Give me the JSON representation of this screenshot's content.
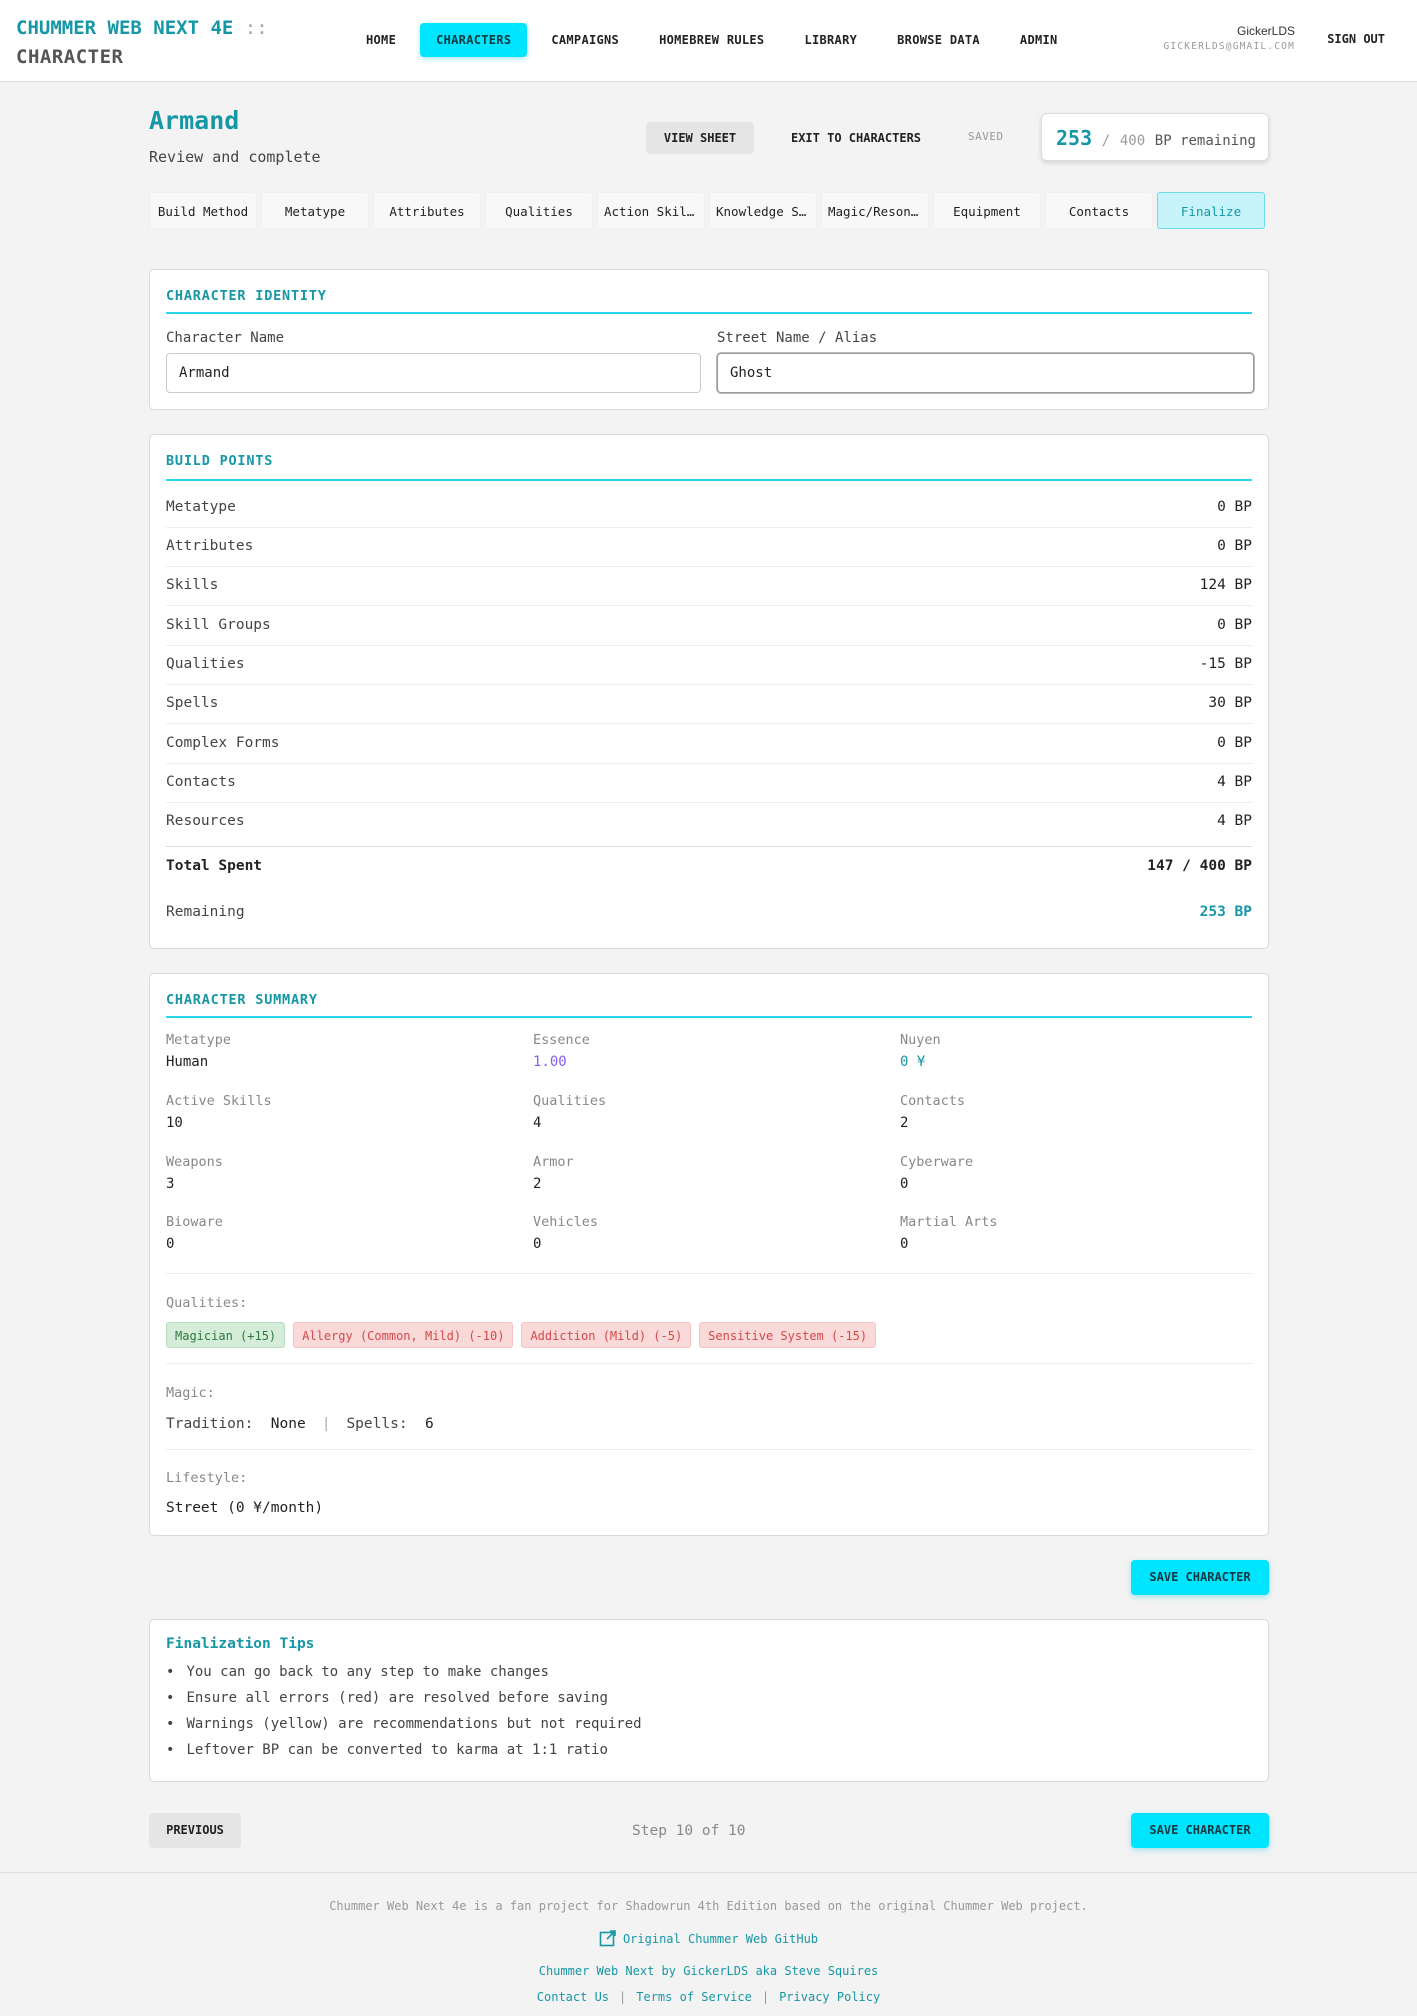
{
  "header": {
    "brand_line1": "CHUMMER WEB NEXT 4E",
    "brand_sep": "::",
    "brand_line2": "CHARACTER",
    "nav": [
      {
        "label": "HOME",
        "active": false
      },
      {
        "label": "CHARACTERS",
        "active": true
      },
      {
        "label": "CAMPAIGNS",
        "active": false
      },
      {
        "label": "HOMEBREW RULES",
        "active": false
      },
      {
        "label": "LIBRARY",
        "active": false
      },
      {
        "label": "BROWSE DATA",
        "active": false
      },
      {
        "label": "ADMIN",
        "active": false
      }
    ],
    "username": "GickerLDS",
    "email": "GICKERLDS@GMAIL.COM",
    "sign_out": "SIGN OUT"
  },
  "page": {
    "title": "Armand",
    "subtitle": "Review and complete",
    "view_sheet": "VIEW SHEET",
    "exit": "EXIT TO CHARACTERS",
    "saved": "SAVED",
    "bp_remaining": "253",
    "bp_slash": "/",
    "bp_max": "400",
    "bp_label": "BP remaining"
  },
  "tabs": [
    "Build Method",
    "Metatype",
    "Attributes",
    "Qualities",
    "Action Skills",
    "Knowledge Skills",
    "Magic/Resonance",
    "Equipment",
    "Contacts",
    "Finalize"
  ],
  "identity": {
    "title": "CHARACTER IDENTITY",
    "name_label": "Character Name",
    "name_value": "Armand",
    "alias_label": "Street Name / Alias",
    "alias_value": "Ghost"
  },
  "build_points": {
    "title": "BUILD POINTS",
    "rows": [
      {
        "k": "Metatype",
        "v": "0 BP"
      },
      {
        "k": "Attributes",
        "v": "0 BP"
      },
      {
        "k": "Skills",
        "v": "124 BP"
      },
      {
        "k": "Skill Groups",
        "v": "0 BP"
      },
      {
        "k": "Qualities",
        "v": "-15 BP"
      },
      {
        "k": "Spells",
        "v": "30 BP"
      },
      {
        "k": "Complex Forms",
        "v": "0 BP"
      },
      {
        "k": "Contacts",
        "v": "4 BP"
      },
      {
        "k": "Resources",
        "v": "4 BP"
      }
    ],
    "total_label": "Total Spent",
    "total_value": "147 / 400 BP",
    "remaining_label": "Remaining",
    "remaining_value": "253 BP"
  },
  "summary": {
    "title": "CHARACTER SUMMARY",
    "cells": [
      {
        "l": "Metatype",
        "v": "Human"
      },
      {
        "l": "Essence",
        "v": "1.00"
      },
      {
        "l": "Nuyen",
        "v": "0 ¥"
      },
      {
        "l": "Active Skills",
        "v": "10"
      },
      {
        "l": "Qualities",
        "v": "4"
      },
      {
        "l": "Contacts",
        "v": "2"
      },
      {
        "l": "Weapons",
        "v": "3"
      },
      {
        "l": "Armor",
        "v": "2"
      },
      {
        "l": "Cyberware",
        "v": "0"
      },
      {
        "l": "Bioware",
        "v": "0"
      },
      {
        "l": "Vehicles",
        "v": "0"
      },
      {
        "l": "Martial Arts",
        "v": "0"
      }
    ],
    "qualities_label": "Qualities:",
    "qualities": [
      {
        "text": "Magician (+15)",
        "kind": "positive"
      },
      {
        "text": "Allergy (Common, Mild) (-10)",
        "kind": "negative"
      },
      {
        "text": "Addiction (Mild) (-5)",
        "kind": "negative"
      },
      {
        "text": "Sensitive System (-15)",
        "kind": "negative"
      }
    ],
    "magic_label": "Magic:",
    "tradition_label": "Tradition:",
    "tradition_value": "None",
    "spells_label": "Spells:",
    "spells_value": "6",
    "lifestyle_label": "Lifestyle:",
    "lifestyle_value": "Street (0 ¥/month)"
  },
  "save_label": "SAVE CHARACTER",
  "tips": {
    "title": "Finalization Tips",
    "items": [
      "You can go back to any step to make changes",
      "Ensure all errors (red) are resolved before saving",
      "Warnings (yellow) are recommendations but not required",
      "Leftover BP can be converted to karma at 1:1 ratio"
    ]
  },
  "pager": {
    "previous": "PREVIOUS",
    "step": "Step 10 of 10",
    "save": "SAVE CHARACTER"
  },
  "footer": {
    "note": "Chummer Web Next 4e is a fan project for Shadowrun 4th Edition based on the original Chummer Web project.",
    "github": "Original Chummer Web GitHub",
    "credit": "Chummer Web Next by GickerLDS aka Steve Squires",
    "contact": "Contact Us",
    "terms": "Terms of Service",
    "privacy": "Privacy Policy"
  },
  "colors": {
    "accent": "#1697a6",
    "nav_active": "#00e5ff",
    "positive_tag": "#d4ecd8",
    "negative_tag": "#fad9d9",
    "essence": "#8a5cf5"
  }
}
